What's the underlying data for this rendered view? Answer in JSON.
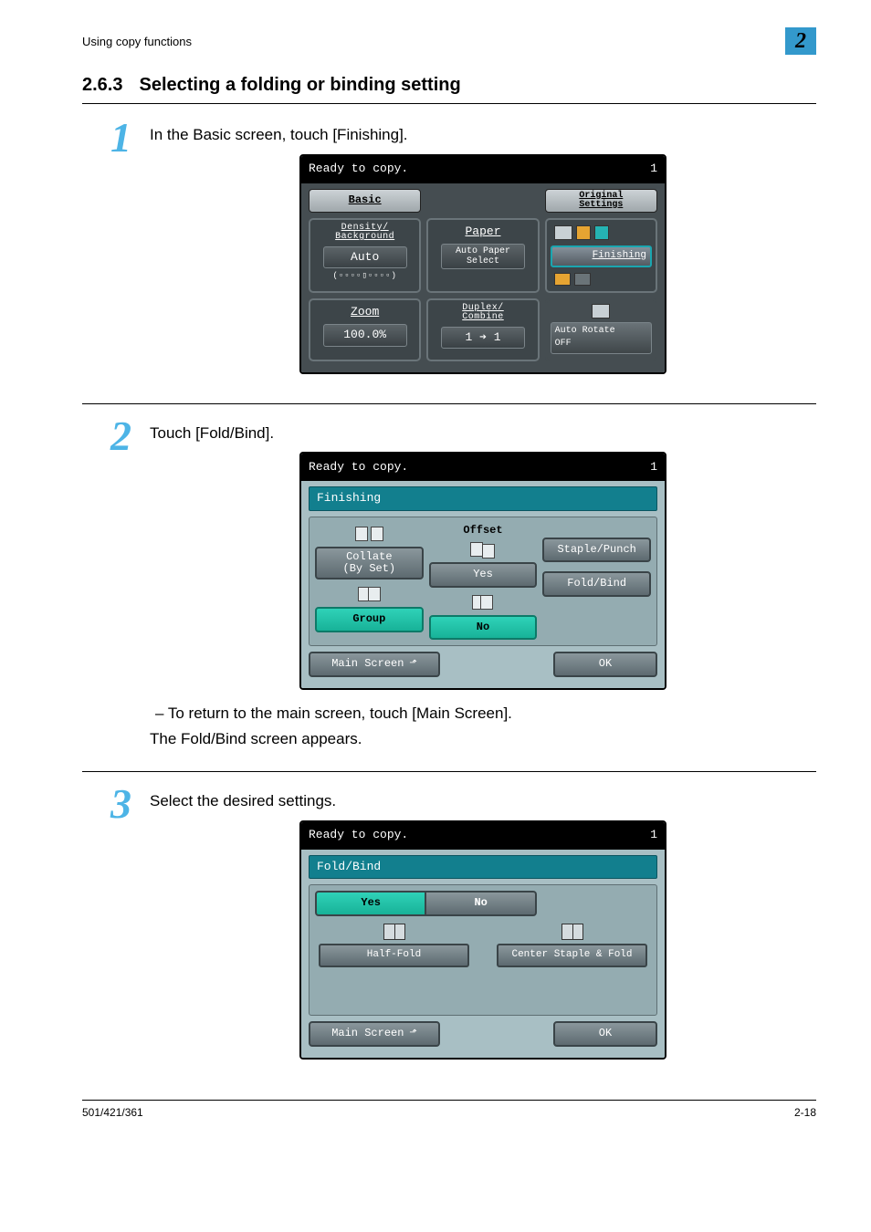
{
  "header": {
    "breadcrumb": "Using copy functions",
    "chapter": "2"
  },
  "section": {
    "number": "2.6.3",
    "title": "Selecting a folding or binding setting"
  },
  "steps": {
    "one": {
      "num": "1",
      "text": "In the Basic screen, touch [Finishing]."
    },
    "two": {
      "num": "2",
      "text": "Touch [Fold/Bind].",
      "note1": "–  To return to the main screen, touch [Main Screen].",
      "note2": "The Fold/Bind screen appears."
    },
    "three": {
      "num": "3",
      "text": "Select the desired settings."
    }
  },
  "screen1": {
    "status": "Ready to copy.",
    "count": "1",
    "tab_basic": "Basic",
    "tab_orig1": "Original",
    "tab_orig2": "Settings",
    "density_hdr": "Density/\nBackground",
    "density_btn": "Auto",
    "paper_hdr": "Paper",
    "paper_btn": "Auto Paper\nSelect",
    "finishing_btn": "Finishing",
    "zoom_hdr": "Zoom",
    "zoom_val": "100.0%",
    "duplex_hdr": "Duplex/\nCombine",
    "duplex_val": "1 ➔ 1",
    "autorotate": "Auto Rotate\nOFF"
  },
  "screen2": {
    "status": "Ready to copy.",
    "count": "1",
    "subbar": "Finishing",
    "collate_label": "Collate\n(By Set)",
    "group_label": "Group",
    "offset_label": "Offset",
    "yes": "Yes",
    "no": "No",
    "staple": "Staple/Punch",
    "foldbind": "Fold/Bind",
    "main_screen": "Main Screen",
    "ok": "OK"
  },
  "screen3": {
    "status": "Ready to copy.",
    "count": "1",
    "subbar": "Fold/Bind",
    "yes": "Yes",
    "no": "No",
    "half_fold": "Half-Fold",
    "center_staple": "Center Staple & Fold",
    "main_screen": "Main Screen",
    "ok": "OK"
  },
  "footer": {
    "left": "501/421/361",
    "right": "2-18"
  }
}
